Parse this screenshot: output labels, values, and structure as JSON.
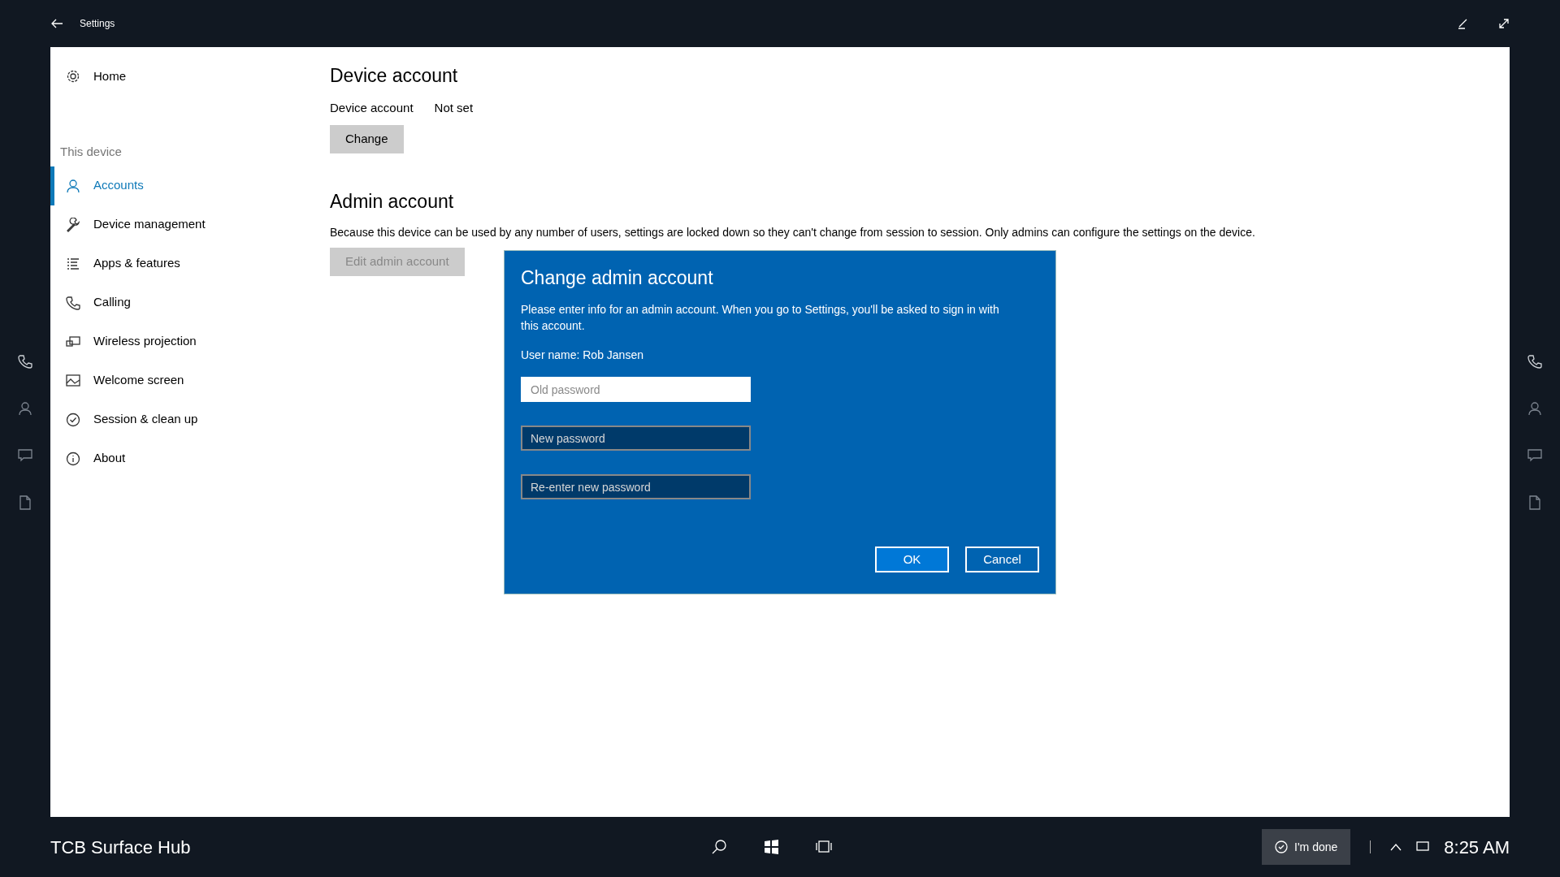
{
  "title_bar": {
    "title": "Settings"
  },
  "sidebar": {
    "home": "Home",
    "section": "This device",
    "items": [
      {
        "label": "Accounts",
        "selected": true
      },
      {
        "label": "Device management",
        "selected": false
      },
      {
        "label": "Apps & features",
        "selected": false
      },
      {
        "label": "Calling",
        "selected": false
      },
      {
        "label": "Wireless projection",
        "selected": false
      },
      {
        "label": "Welcome screen",
        "selected": false
      },
      {
        "label": "Session & clean up",
        "selected": false
      },
      {
        "label": "About",
        "selected": false
      }
    ]
  },
  "device_account": {
    "heading": "Device account",
    "label": "Device account",
    "value": "Not set",
    "button": "Change"
  },
  "admin_account": {
    "heading": "Admin account",
    "description": "Because this device can be used by any number of users, settings are locked down so they can't change from session to session. Only admins can configure the settings on the device.",
    "button": {
      "label": "Edit admin account",
      "disabled": true
    }
  },
  "dialog": {
    "title": "Change admin account",
    "message": "Please enter info for an admin account. When you go to Settings, you'll be asked to sign in with this account.",
    "user_name": "User name: Rob Jansen",
    "fields": [
      {
        "placeholder": "Old password",
        "focused": true
      },
      {
        "placeholder": "New password",
        "focused": false
      },
      {
        "placeholder": "Re-enter new password",
        "focused": false
      }
    ],
    "buttons": [
      {
        "label": "OK",
        "kind": "primary"
      },
      {
        "label": "Cancel",
        "kind": "secondary"
      }
    ]
  },
  "taskbar": {
    "device_name": "TCB Surface Hub",
    "done_button": "I'm done",
    "time": "8:25 AM"
  }
}
